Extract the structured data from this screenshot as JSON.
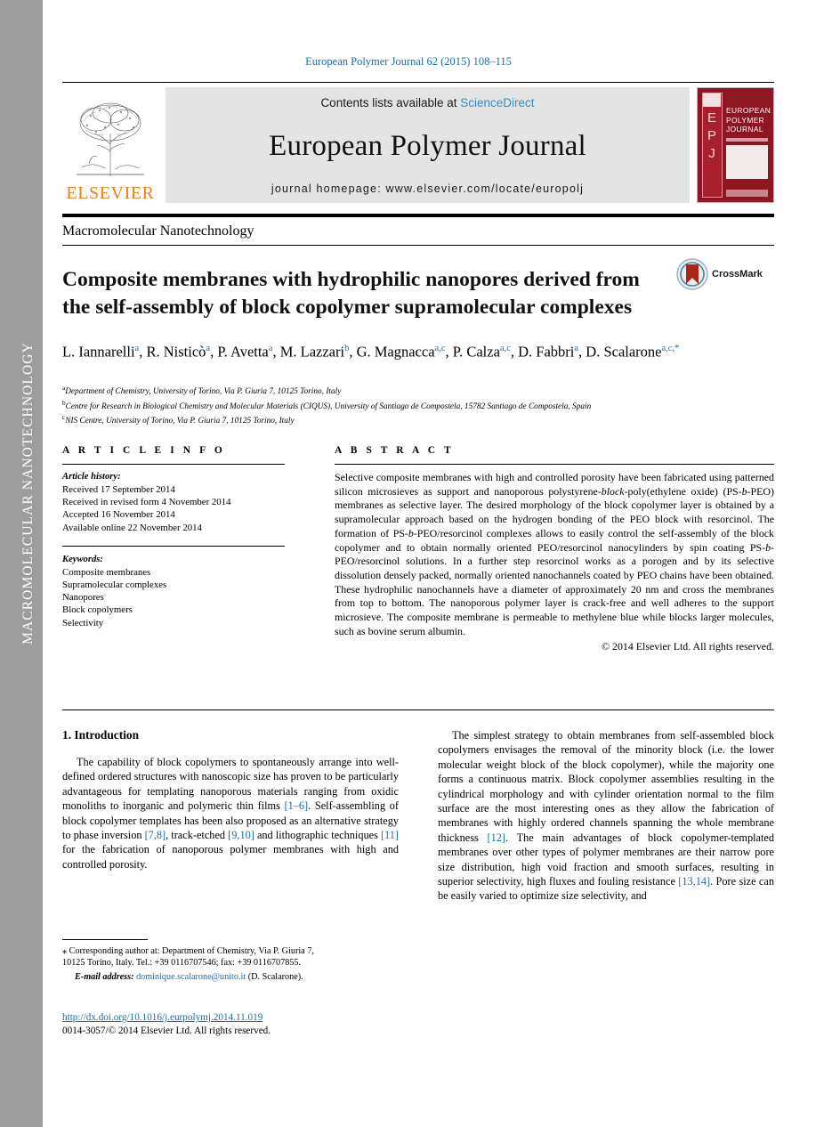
{
  "side_bar": {
    "label": "MACROMOLECULAR NANOTECHNOLOGY"
  },
  "running_head": "European Polymer Journal 62 (2015) 108–115",
  "masthead": {
    "contents_prefix": "Contents lists available at ",
    "sciencedirect": "ScienceDirect",
    "journal_title": "European Polymer Journal",
    "homepage": "journal homepage: www.elsevier.com/locate/europolj",
    "publisher_wordmark": "ELSEVIER",
    "cover": {
      "letters": [
        "E",
        "P",
        "J"
      ],
      "title_lines": [
        "EUROPEAN",
        "POLYMER",
        "JOURNAL"
      ]
    }
  },
  "kicker": "Macromolecular Nanotechnology",
  "title": "Composite membranes with hydrophilic nanopores derived from the self-assembly of block copolymer supramolecular complexes",
  "crossmark": {
    "label": "CrossMark"
  },
  "authors": [
    {
      "name": "L. Iannarelli",
      "sup": "a",
      "sep": ", "
    },
    {
      "name": "R. Nisticò",
      "sup": "a",
      "sep": ", "
    },
    {
      "name": "P. Avetta",
      "sup": "a",
      "sep": ", "
    },
    {
      "name": "M. Lazzari",
      "sup": "b",
      "sep": ", "
    },
    {
      "name": "G. Magnacca",
      "sup": "a,c",
      "sep": ", "
    },
    {
      "name": "P. Calza",
      "sup": "a,c",
      "sep": ", "
    },
    {
      "name": "D. Fabbri",
      "sup": "a",
      "sep": ", "
    },
    {
      "name": "D. Scalarone",
      "sup": "a,c,*",
      "sep": ""
    }
  ],
  "affiliations": [
    {
      "mark": "a",
      "text": "Department of Chemistry, University of Torino, Via P. Giuria 7, 10125 Torino, Italy"
    },
    {
      "mark": "b",
      "text": "Centre for Research in Biological Chemistry and Molecular Materials (CIQUS), University of Santiago de Compostela, 15782 Santiago de Compostela, Spain"
    },
    {
      "mark": "c",
      "text": "NIS Centre, University of Torino, Via P. Giuria 7, 10125 Torino, Italy"
    }
  ],
  "article_info": {
    "heading": "A R T I C L E   I N F O",
    "history_label": "Article history:",
    "history": [
      "Received 17 September 2014",
      "Received in revised form 4 November 2014",
      "Accepted 16 November 2014",
      "Available online 22 November 2014"
    ],
    "keywords_label": "Keywords:",
    "keywords": [
      "Composite membranes",
      "Supramolecular complexes",
      "Nanopores",
      "Block copolymers",
      "Selectivity"
    ]
  },
  "abstract": {
    "heading": "A B S T R A C T",
    "text": "Selective composite membranes with high and controlled porosity have been fabricated using patterned silicon microsieves as support and nanoporous polystyrene-block-poly(ethylene oxide) (PS-b-PEO) membranes as selective layer. The desired morphology of the block copolymer layer is obtained by a supramolecular approach based on the hydrogen bonding of the PEO block with resorcinol. The formation of PS-b-PEO/resorcinol complexes allows to easily control the self-assembly of the block copolymer and to obtain normally oriented PEO/resorcinol nanocylinders by spin coating PS-b-PEO/resorcinol solutions. In a further step resorcinol works as a porogen and by its selective dissolution densely packed, normally oriented nanochannels coated by PEO chains have been obtained. These hydrophilic nanochannels have a diameter of approximately 20 nm and cross the membranes from top to bottom. The nanoporous polymer layer is crack-free and well adheres to the support microsieve. The composite membrane is permeable to methylene blue while blocks larger molecules, such as bovine serum albumin.",
    "copyright": "© 2014 Elsevier Ltd. All rights reserved."
  },
  "body": {
    "section_number_title": "1. Introduction",
    "left_paragraph_parts": [
      "The capability of block copolymers to spontaneously arrange into well-defined ordered structures with nanoscopic size has proven to be particularly advantageous for templating nanoporous materials ranging from oxidic monoliths to inorganic and polymeric thin films ",
      "[1–6]",
      ". Self-assembling of block copolymer templates has been also proposed as an alternative strategy to phase inversion ",
      "[7,8]",
      ", track-etched ",
      "[9,10]",
      " and lithographic techniques ",
      "[11]",
      " for the fabrication of nanoporous polymer membranes with high and controlled porosity."
    ],
    "right_paragraph_parts": [
      "The simplest strategy to obtain membranes from self-assembled block copolymers envisages the removal of the minority block (i.e. the lower molecular weight block of the block copolymer), while the majority one forms a continuous matrix. Block copolymer assemblies resulting in the cylindrical morphology and with cylinder orientation normal to the film surface are the most interesting ones as they allow the fabrication of membranes with highly ordered channels spanning the whole membrane thickness ",
      "[12]",
      ". The main advantages of block copolymer-templated membranes over other types of polymer membranes are their narrow pore size distribution, high void fraction and smooth surfaces, resulting in superior selectivity, high fluxes and fouling resistance ",
      "[13,14]",
      ". Pore size can be easily varied to optimize size selectivity, and"
    ]
  },
  "footnote": {
    "line1": "⁎ Corresponding author at: Department of Chemistry, Via P. Giuria 7,",
    "line2": "10125 Torino, Italy. Tel.: +39 0116707546; fax: +39 0116707855.",
    "email_label": "E-mail address:",
    "email": "dominique.scalarone@unito.it",
    "email_suffix": " (D. Scalarone)."
  },
  "doi": {
    "url": "http://dx.doi.org/10.1016/j.eurpolymj.2014.11.019",
    "copyright": "0014-3057/© 2014 Elsevier Ltd. All rights reserved."
  },
  "colors": {
    "link": "#1b6ea8",
    "sciencedirect": "#2d8fc9",
    "elsevier_orange": "#f07f13",
    "sidebar_gray": "#9d9d9d",
    "masthead_band": "#e4e4e4",
    "cover_red": "#8e1622"
  }
}
